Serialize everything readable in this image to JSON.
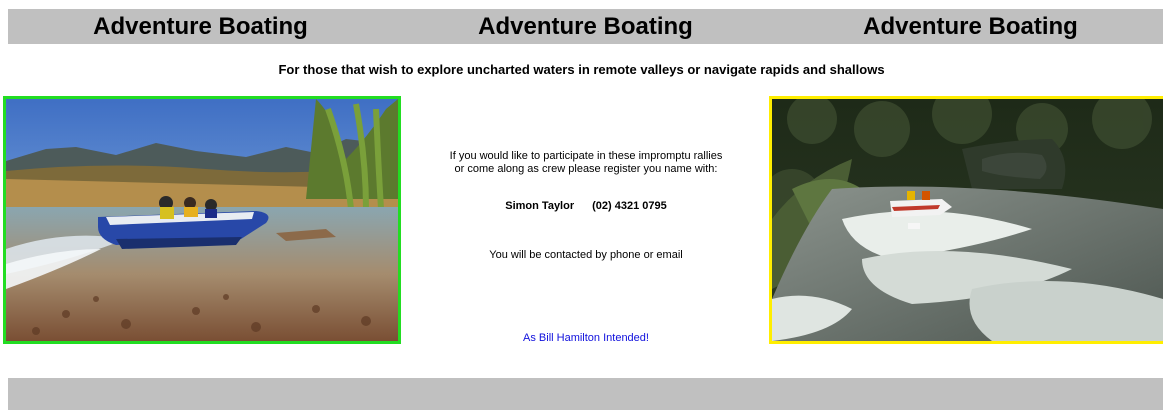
{
  "header": {
    "titles": [
      "Adventure Boating",
      "Adventure Boating",
      "Adventure Boating"
    ]
  },
  "tagline": "For those that wish to explore uncharted waters in remote valleys or navigate rapids and shallows",
  "center": {
    "intro_line1": "If you would like to participate in these impromptu rallies",
    "intro_line2": "or come along as crew please register you name with:",
    "contact_name": "Simon Taylor",
    "contact_phone": "(02) 4321 0795",
    "contacted_text": "You will be contacted by phone or email",
    "hamilton_link": "As Bill Hamilton Intended!"
  },
  "images": {
    "left": "jet-boat-shallows-photo",
    "right": "jet-boat-rapids-photo"
  },
  "colors": {
    "header_bar": "#c0c0c0",
    "left_photo_border": "#22dd22",
    "right_photo_border": "#ffee00",
    "link": "#1010dd"
  }
}
